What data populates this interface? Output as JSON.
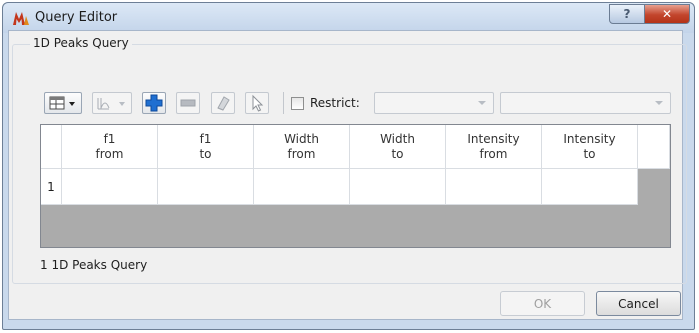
{
  "window": {
    "title": "Query Editor",
    "help_label": "?",
    "close_label": "✕"
  },
  "group": {
    "label": "1D Peaks Query"
  },
  "toolbar": {
    "restrict_label": "Restrict:",
    "restrict_checked": false,
    "combo1_value": "",
    "combo2_value": ""
  },
  "grid": {
    "columns": [
      {
        "line1": "f1",
        "line2": "from"
      },
      {
        "line1": "f1",
        "line2": "to"
      },
      {
        "line1": "Width",
        "line2": "from"
      },
      {
        "line1": "Width",
        "line2": "to"
      },
      {
        "line1": "Intensity",
        "line2": "from"
      },
      {
        "line1": "Intensity",
        "line2": "to"
      }
    ],
    "rows": [
      {
        "number": "1",
        "cells": [
          "",
          "",
          "",
          "",
          "",
          ""
        ]
      }
    ]
  },
  "status": "1 1D Peaks Query",
  "buttons": {
    "ok": "OK",
    "cancel": "Cancel"
  },
  "colors": {
    "accent_blue": "#1f6fd1",
    "close_red": "#c2452c",
    "title_bar": "#c9d9ec"
  }
}
